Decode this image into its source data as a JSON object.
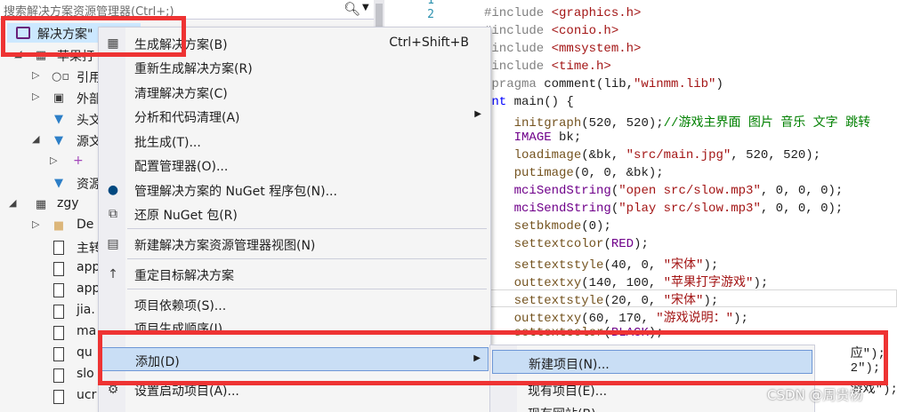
{
  "explorer": {
    "search_placeholder": "搜索解决方案资源管理器(Ctrl+;)",
    "solution_label": "解决方案\"",
    "tree": [
      {
        "label": "苹果打",
        "icon": "project-icon"
      },
      {
        "label": "引用",
        "icon": "reference-icon"
      },
      {
        "label": "外部",
        "icon": "external-deps-icon"
      },
      {
        "label": "头文",
        "icon": "filter-icon"
      },
      {
        "label": "源文",
        "icon": "filter-icon"
      },
      {
        "label": "+",
        "icon": "cpp-file-icon"
      },
      {
        "label": "资源",
        "icon": "filter-icon"
      },
      {
        "label": "zgy",
        "icon": "project-icon"
      },
      {
        "label": "De",
        "icon": "folder-icon"
      },
      {
        "label": "主转",
        "icon": "file-icon"
      },
      {
        "label": "app",
        "icon": "file-icon"
      },
      {
        "label": "app",
        "icon": "file-icon"
      },
      {
        "label": "jia.",
        "icon": "file-icon"
      },
      {
        "label": "ma",
        "icon": "file-icon"
      },
      {
        "label": "qu",
        "icon": "file-icon"
      },
      {
        "label": "slo",
        "icon": "file-icon"
      },
      {
        "label": "ucr",
        "icon": "file-icon"
      }
    ]
  },
  "editor": {
    "line_numbers": [
      "1",
      "2"
    ],
    "lines": [
      "#include <stdio.h>",
      "#include <graphics.h>",
      "#include <conio.h>",
      "#include <mmsystem.h>",
      "#include <time.h>",
      "#pragma comment(lib,\"winmm.lib\")",
      "int main() {",
      "    initgraph(520, 520);//游戏主界面 图片 音乐 文字 跳转",
      "    IMAGE bk;",
      "    loadimage(&bk, \"src/main.jpg\", 520, 520);",
      "    putimage(0, 0, &bk);",
      "    mciSendString(\"open src/slow.mp3\", 0, 0, 0);",
      "    mciSendString(\"play src/slow.mp3\", 0, 0, 0);",
      "    setbkmode(0);",
      "    settextcolor(RED);",
      "    settextstyle(40, 0, \"宋体\");",
      "    outtextxy(140, 100, \"苹果打字游戏\");",
      "    settextstyle(20, 0, \"宋体\");",
      "    outtextxy(60, 170, \"游戏说明：\");",
      "    settextcolor(BLACK);",
      "                                                 应\");",
      "                                                 2\");",
      "                                                 游戏\");"
    ]
  },
  "context_menu": {
    "items": [
      {
        "label": "生成解决方案(B)",
        "shortcut": "Ctrl+Shift+B",
        "icon": "build-icon"
      },
      {
        "label": "重新生成解决方案(R)",
        "shortcut": "",
        "icon": ""
      },
      {
        "label": "清理解决方案(C)",
        "shortcut": "",
        "icon": ""
      },
      {
        "label": "分析和代码清理(A)",
        "shortcut": "",
        "icon": ""
      },
      {
        "label": "批生成(T)...",
        "shortcut": "",
        "icon": ""
      },
      {
        "label": "配置管理器(O)...",
        "shortcut": "",
        "icon": ""
      },
      {
        "label": "管理解决方案的 NuGet 程序包(N)...",
        "shortcut": "",
        "icon": "nuget-icon"
      },
      {
        "label": "还原 NuGet 包(R)",
        "shortcut": "",
        "icon": "restore-icon"
      },
      {
        "label": "新建解决方案资源管理器视图(N)",
        "shortcut": "",
        "icon": "new-view-icon"
      },
      {
        "label": "重定目标解决方案",
        "shortcut": "",
        "icon": "retarget-icon"
      },
      {
        "label": "项目依赖项(S)...",
        "shortcut": "",
        "icon": ""
      },
      {
        "label": "项目生成顺序(I)...",
        "shortcut": "",
        "icon": ""
      },
      {
        "label": "添加(D)",
        "shortcut": "",
        "icon": ""
      },
      {
        "label": "设置启动项目(A)...",
        "shortcut": "",
        "icon": "gear-icon"
      }
    ]
  },
  "submenu": {
    "items": [
      {
        "label": "新建项目(N)..."
      },
      {
        "label": "现有项目(E)..."
      },
      {
        "label": "现有网站(B)..."
      }
    ]
  },
  "watermark": "CSDN @周贵杨",
  "colors": {
    "highlight": "#c9def5",
    "annotation": "#ee3333",
    "keyword": "#0000ff",
    "string": "#a31515"
  }
}
